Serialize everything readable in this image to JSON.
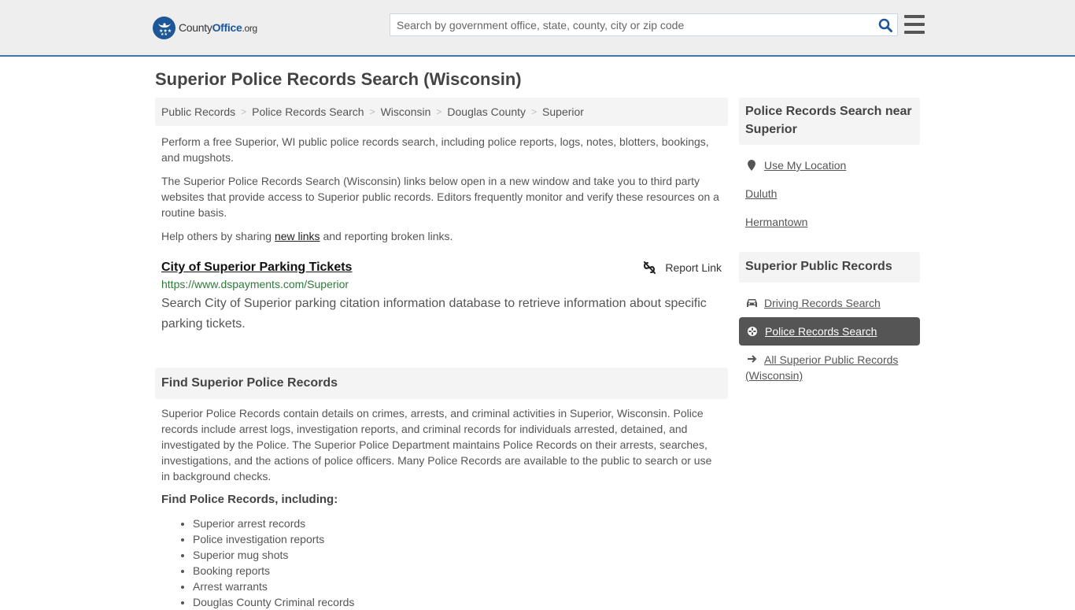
{
  "header": {
    "logo": {
      "prefix": "County",
      "brand": "Office",
      "suffix": ".org"
    },
    "search": {
      "placeholder": "Search by government office, state, county, city or zip code",
      "value": ""
    },
    "icons": {
      "search": "search-icon",
      "menu": "hamburger-menu-icon",
      "logo": "eagle-stars-icon"
    }
  },
  "page": {
    "title": "Superior Police Records Search (Wisconsin)"
  },
  "breadcrumb": [
    {
      "label": "Public Records"
    },
    {
      "label": "Police Records Search"
    },
    {
      "label": "Wisconsin"
    },
    {
      "label": "Douglas County"
    },
    {
      "label": "Superior"
    }
  ],
  "intro": {
    "p1": "Perform a free Superior, WI public police records search, including police reports, logs, notes, blotters, bookings, and mugshots.",
    "p2": "The Superior Police Records Search (Wisconsin) links below open in a new window and take you to third party websites that provide access to Superior public records. Editors frequently monitor and verify these resources on a routine basis.",
    "p3_before": "Help others by sharing ",
    "p3_link": "new links",
    "p3_after": " and reporting broken links."
  },
  "results": [
    {
      "title": "City of Superior Parking Tickets",
      "url": "https://www.dspayments.com/Superior",
      "description": "Search City of Superior parking citation information database to retrieve information about specific parking tickets.",
      "report_label": "Report Link"
    }
  ],
  "find_section": {
    "heading": "Find Superior Police Records",
    "body": "Superior Police Records contain details on crimes, arrests, and criminal activities in Superior, Wisconsin. Police records include arrest logs, investigation reports, and criminal records for individuals arrested, detained, and investigated by the Police. The Superior Police Department maintains Police Records on their arrests, searches, investigations, and the actions of police officers. Many Police Records are available to the public to search or use in background checks.",
    "subheading": "Find Police Records, including:",
    "items": [
      "Superior arrest records",
      "Police investigation reports",
      "Superior mug shots",
      "Booking reports",
      "Arrest warrants",
      "Douglas County Criminal records"
    ]
  },
  "sidebar": {
    "near": {
      "heading": "Police Records Search near Superior",
      "use_location": "Use My Location",
      "cities": [
        "Duluth",
        "Hermantown"
      ]
    },
    "public_records": {
      "heading": "Superior Public Records",
      "links": [
        {
          "label": "Driving Records Search",
          "icon": "car-icon",
          "active": false
        },
        {
          "label": "Police Records Search",
          "icon": "crosshair-icon",
          "active": true
        },
        {
          "label": "All Superior Public Records (Wisconsin)",
          "icon": "arrow-right-icon",
          "active": false
        }
      ]
    }
  },
  "colors": {
    "brand": "#1d5797",
    "header_border": "#3a78b0",
    "url_green": "#2f7a3a",
    "active_bg": "#555555"
  }
}
